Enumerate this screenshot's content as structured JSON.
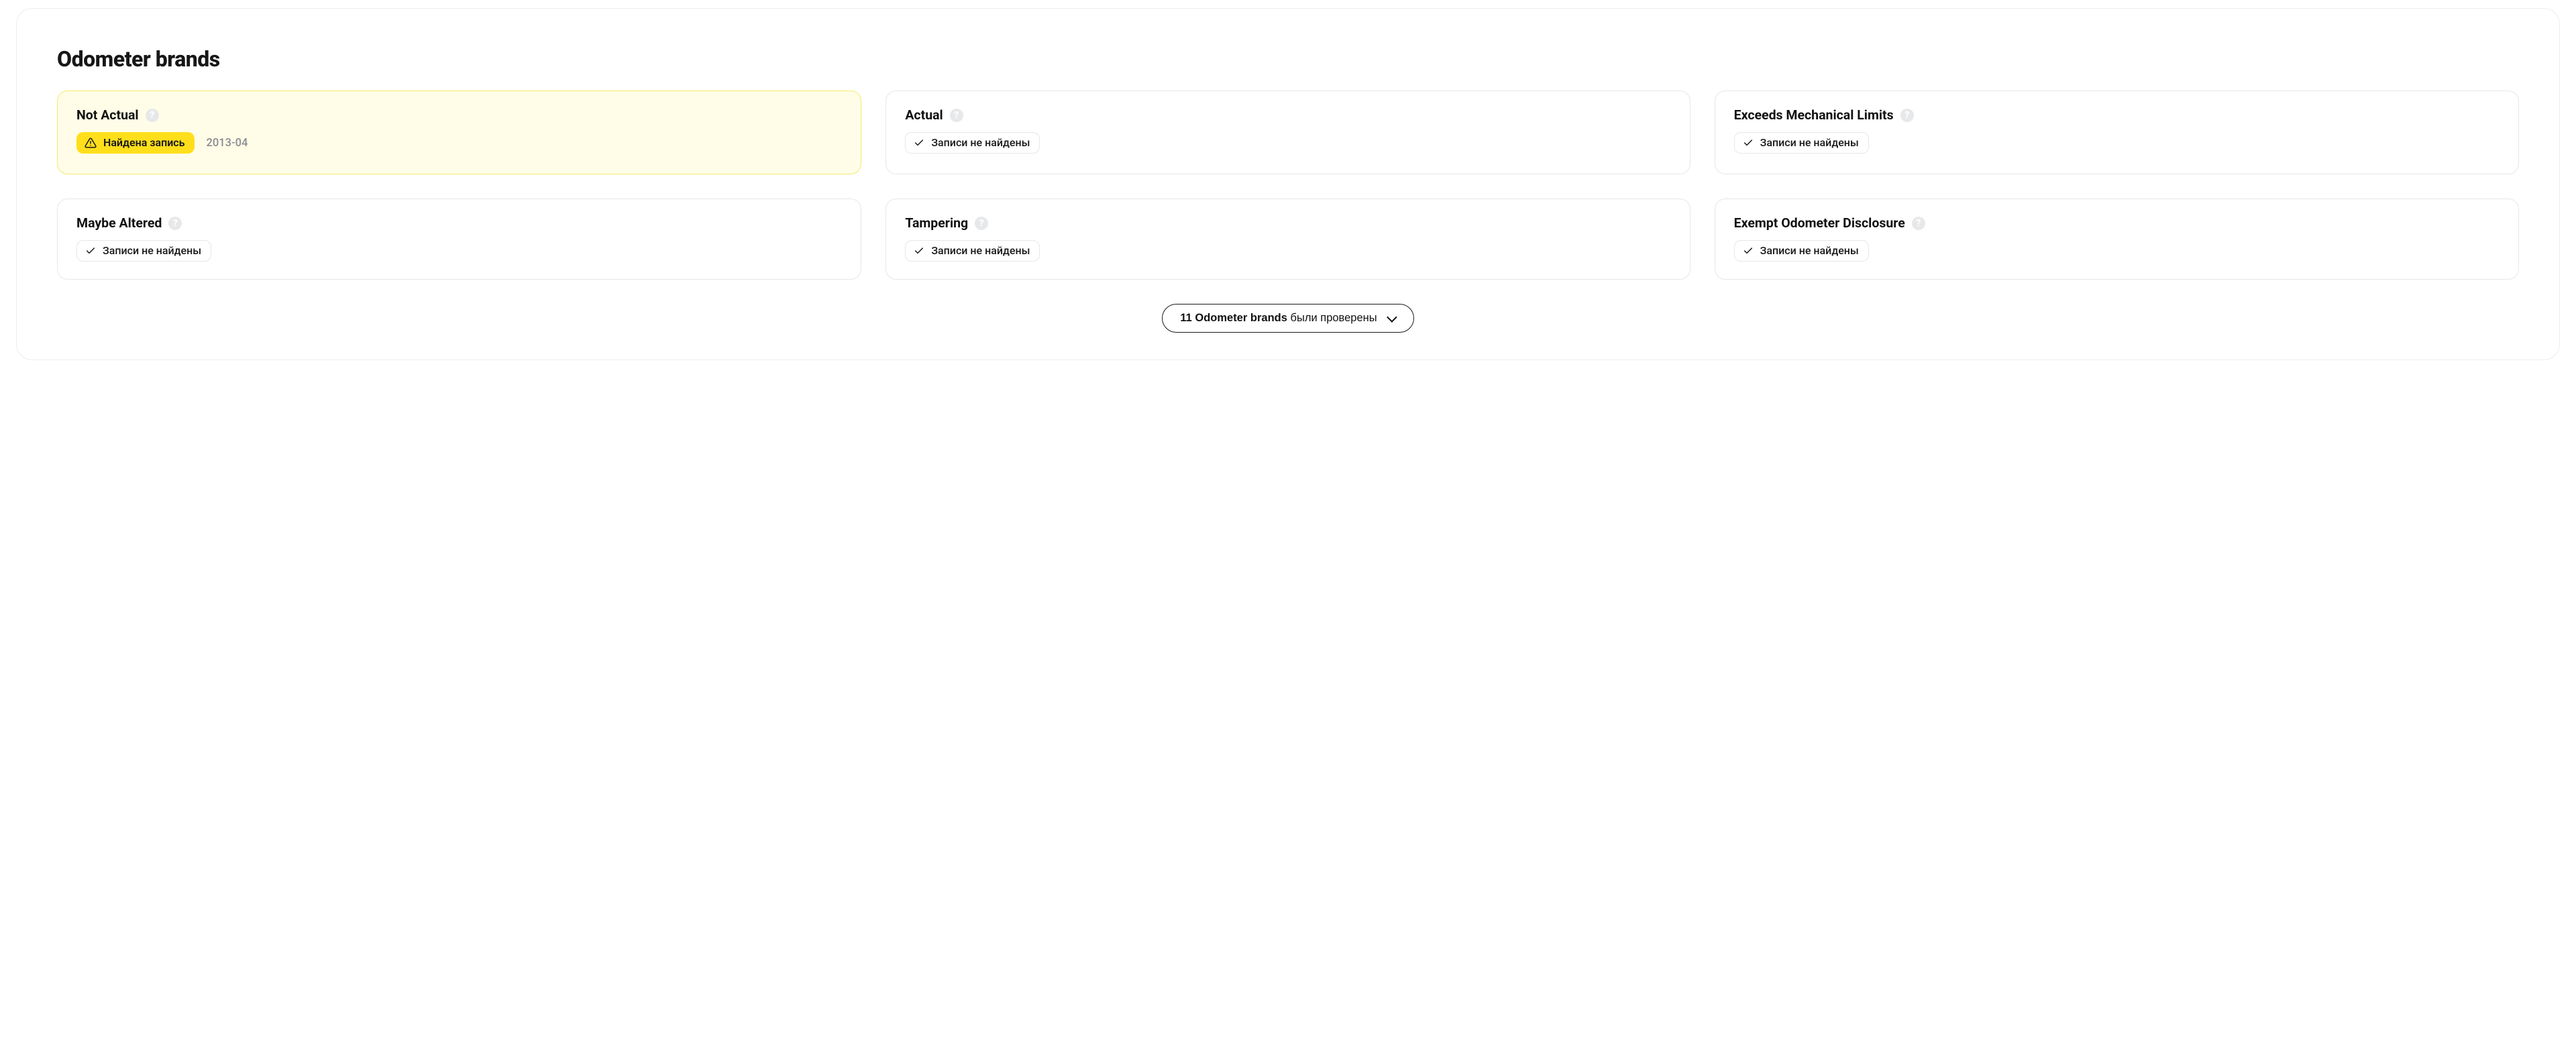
{
  "section": {
    "title": "Odometer brands"
  },
  "cards": [
    {
      "title": "Not Actual",
      "status": "found",
      "badge": "Найдена запись",
      "date": "2013-04"
    },
    {
      "title": "Actual",
      "status": "clean",
      "badge": "Записи не найдены",
      "date": null
    },
    {
      "title": "Exceeds Mechanical Limits",
      "status": "clean",
      "badge": "Записи не найдены",
      "date": null
    },
    {
      "title": "Maybe Altered",
      "status": "clean",
      "badge": "Записи не найдены",
      "date": null
    },
    {
      "title": "Tampering",
      "status": "clean",
      "badge": "Записи не найдены",
      "date": null
    },
    {
      "title": "Exempt Odometer Disclosure",
      "status": "clean",
      "badge": "Записи не найдены",
      "date": null
    }
  ],
  "footer": {
    "count_label": "11 Odometer brands",
    "rest_label": "были проверены"
  },
  "help_glyph": "?"
}
